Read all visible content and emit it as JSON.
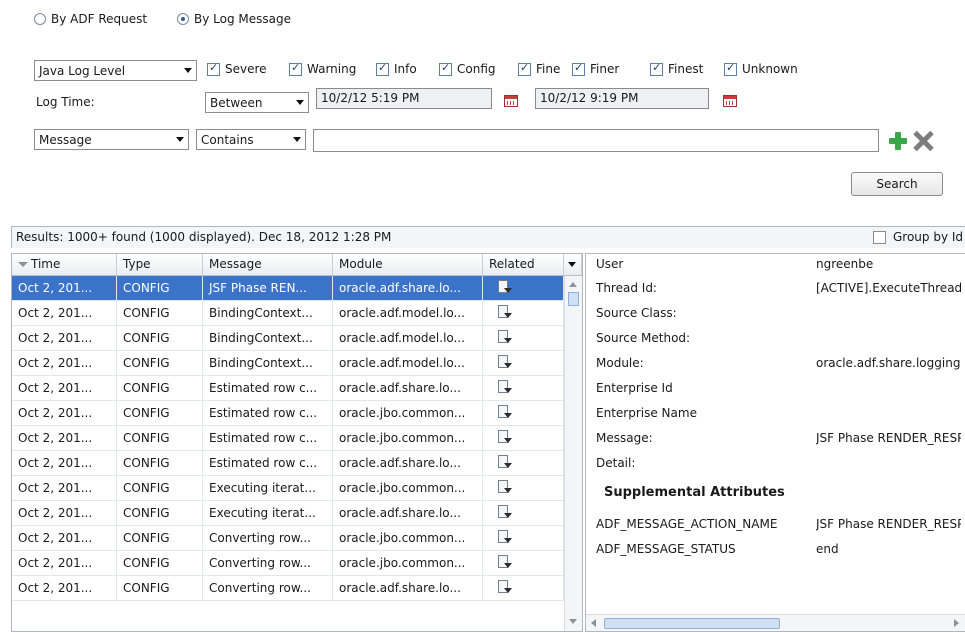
{
  "mode": {
    "options": [
      {
        "label": "By ADF Request",
        "selected": false
      },
      {
        "label": "By Log Message",
        "selected": true
      }
    ]
  },
  "filters": {
    "level_select": "Java Log Level",
    "levels": [
      {
        "label": "Severe",
        "checked": true
      },
      {
        "label": "Warning",
        "checked": true
      },
      {
        "label": "Info",
        "checked": true
      },
      {
        "label": "Config",
        "checked": true
      },
      {
        "label": "Fine",
        "checked": true
      },
      {
        "label": "Finer",
        "checked": true
      },
      {
        "label": "Finest",
        "checked": true
      },
      {
        "label": "Unknown",
        "checked": true
      }
    ],
    "log_time_label": "Log Time:",
    "time_operator": "Between",
    "start_time": "10/2/12 5:19 PM",
    "end_time": "10/2/12 9:19 PM",
    "field_select": "Message",
    "match_select": "Contains",
    "search_value": "",
    "search_button": "Search"
  },
  "results": {
    "summary": "Results:  1000+ found (1000 displayed). Dec 18, 2012 1:28 PM",
    "group_by_label": "Group by Id",
    "columns": [
      "Time",
      "Type",
      "Message",
      "Module",
      "Related"
    ],
    "rows": [
      {
        "time": "Oct 2, 201...",
        "type": "CONFIG",
        "message": "JSF Phase REN...",
        "module": "oracle.adf.share.lo...",
        "selected": true
      },
      {
        "time": "Oct 2, 201...",
        "type": "CONFIG",
        "message": "BindingContext...",
        "module": "oracle.adf.model.lo..."
      },
      {
        "time": "Oct 2, 201...",
        "type": "CONFIG",
        "message": "BindingContext...",
        "module": "oracle.adf.model.lo..."
      },
      {
        "time": "Oct 2, 201...",
        "type": "CONFIG",
        "message": "BindingContext...",
        "module": "oracle.adf.model.lo..."
      },
      {
        "time": "Oct 2, 201...",
        "type": "CONFIG",
        "message": "Estimated row c...",
        "module": "oracle.adf.share.lo..."
      },
      {
        "time": "Oct 2, 201...",
        "type": "CONFIG",
        "message": "Estimated row c...",
        "module": "oracle.jbo.common..."
      },
      {
        "time": "Oct 2, 201...",
        "type": "CONFIG",
        "message": "Estimated row c...",
        "module": "oracle.jbo.common..."
      },
      {
        "time": "Oct 2, 201...",
        "type": "CONFIG",
        "message": "Estimated row c...",
        "module": "oracle.adf.share.lo..."
      },
      {
        "time": "Oct 2, 201...",
        "type": "CONFIG",
        "message": "Executing iterat...",
        "module": "oracle.jbo.common..."
      },
      {
        "time": "Oct 2, 201...",
        "type": "CONFIG",
        "message": "Executing iterat...",
        "module": "oracle.adf.share.lo..."
      },
      {
        "time": "Oct 2, 201...",
        "type": "CONFIG",
        "message": "Converting row...",
        "module": "oracle.jbo.common..."
      },
      {
        "time": "Oct 2, 201...",
        "type": "CONFIG",
        "message": "Converting row...",
        "module": "oracle.jbo.common..."
      },
      {
        "time": "Oct 2, 201...",
        "type": "CONFIG",
        "message": "Converting row...",
        "module": "oracle.adf.share.lo..."
      }
    ]
  },
  "detail": {
    "fields": [
      {
        "label": "User",
        "value": "ngreenbe"
      },
      {
        "label": "Thread Id:",
        "value": "[ACTIVE].ExecuteThread"
      },
      {
        "label": "Source Class:",
        "value": ""
      },
      {
        "label": "Source Method:",
        "value": ""
      },
      {
        "label": "Module:",
        "value": "oracle.adf.share.logging"
      },
      {
        "label": "Enterprise Id",
        "value": ""
      },
      {
        "label": "Enterprise Name",
        "value": ""
      },
      {
        "label": "Message:",
        "value": "JSF Phase RENDER_RESPONSE"
      },
      {
        "label": "Detail:",
        "value": ""
      }
    ],
    "supplemental_heading": "Supplemental Attributes",
    "supplemental": [
      {
        "label": "ADF_MESSAGE_ACTION_NAME",
        "value": "JSF Phase RENDER_RESPONSE"
      },
      {
        "label": "ADF_MESSAGE_STATUS",
        "value": "end"
      }
    ]
  },
  "colors": {
    "selection": "#3b73c9",
    "add": "#3aa648",
    "remove": "#7d7d7d"
  }
}
